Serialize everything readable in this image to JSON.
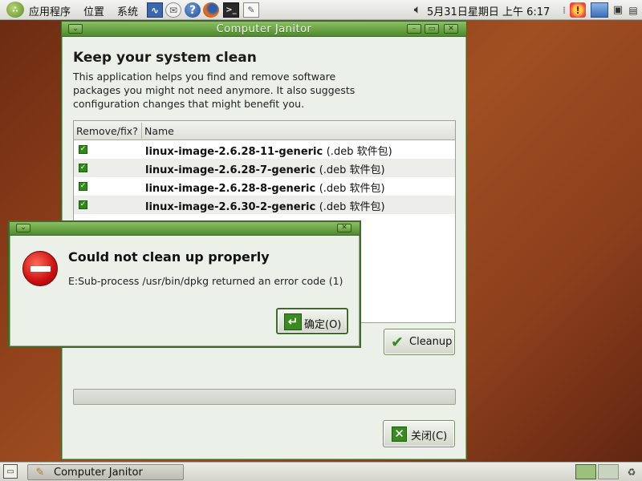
{
  "top_panel": {
    "menus": [
      "应用程序",
      "位置",
      "系统"
    ],
    "clock": "5月31日星期日 上午 6:17"
  },
  "main_window": {
    "title": "Computer Janitor",
    "heading": "Keep your system clean",
    "description": "This application helps you find and remove software packages you might not need anymore. It also suggests configuration changes that might benefit you.",
    "columns": [
      "Remove/fix?",
      "Name"
    ],
    "packages": [
      {
        "name": "linux-image-2.6.28-11-generic",
        "type": "(.deb 软件包)",
        "checked": true
      },
      {
        "name": "linux-image-2.6.28-7-generic",
        "type": "(.deb 软件包)",
        "checked": true
      },
      {
        "name": "linux-image-2.6.28-8-generic",
        "type": "(.deb 软件包)",
        "checked": true
      },
      {
        "name": "linux-image-2.6.30-2-generic",
        "type": "(.deb 软件包)",
        "checked": true
      }
    ],
    "cleanup_label": "Cleanup",
    "close_label": "关闭(C)"
  },
  "error_dialog": {
    "heading": "Could not clean up properly",
    "message": "E:Sub-process /usr/bin/dpkg returned an error code (1)",
    "ok_label": "确定(O)"
  },
  "taskbar": {
    "item_label": "Computer Janitor"
  },
  "colors": {
    "titlebar": "#4f8a2e",
    "window_bg": "#ebf0e8",
    "desktop": "#8a3c18",
    "error_red": "#cc0f0f"
  },
  "icons": {
    "panel_left": [
      "gnome-foot-icon",
      "network-monitor-icon",
      "mail-icon",
      "help-icon",
      "firefox-icon",
      "terminal-icon",
      "text-editor-icon"
    ],
    "panel_right": [
      "volume-icon",
      "update-alert-icon",
      "screenshot-icon",
      "network-icon",
      "power-icon"
    ]
  }
}
